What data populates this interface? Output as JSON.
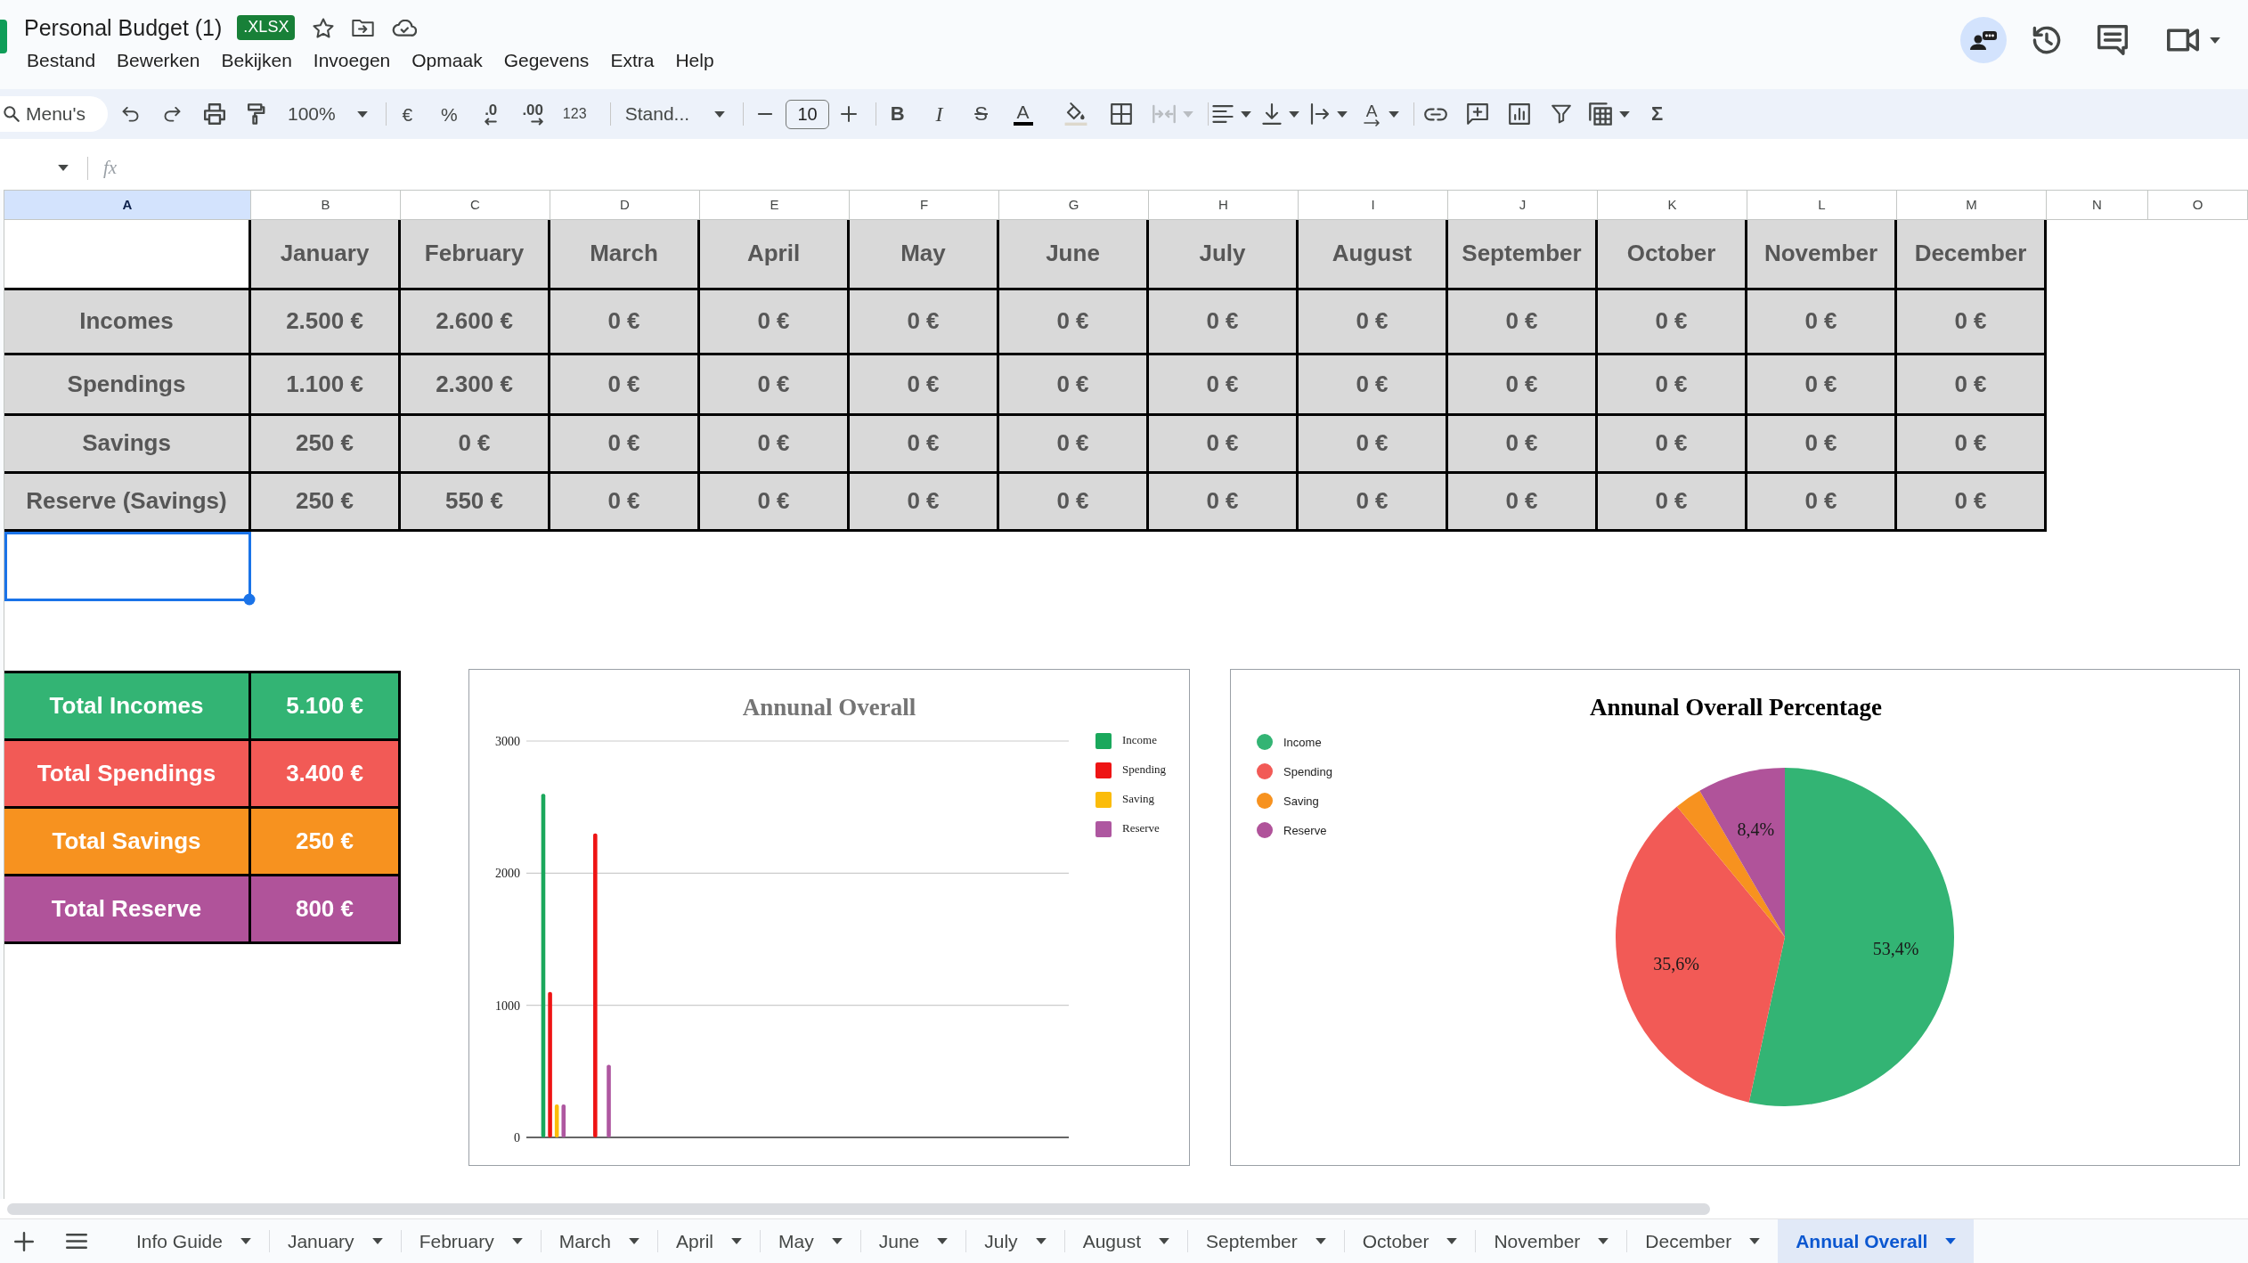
{
  "document": {
    "title": "Personal Budget (1)",
    "format": ".XLSX"
  },
  "menu": [
    "Bestand",
    "Bewerken",
    "Bekijken",
    "Invoegen",
    "Opmaak",
    "Gegevens",
    "Extra",
    "Help"
  ],
  "toolbar": {
    "menu_search": {
      "placeholder": "Menu's"
    },
    "zoom": "100%",
    "currency": "€",
    "percent": "%",
    "decrease_decimals": ".0",
    "increase_decimals": ".00",
    "more_formats": "123",
    "font": "Stand...",
    "font_size": "10",
    "bold": "B",
    "italic": "I",
    "strikethrough": "S",
    "text_color": "A",
    "merge_cells": {
      "disabled": true
    },
    "text_rotation": "A",
    "functions": "Σ"
  },
  "formula_bar": {
    "function_label": "fx"
  },
  "columns": [
    {
      "label": "A",
      "selected": true
    },
    {
      "label": "B",
      "selected": false
    },
    {
      "label": "C",
      "selected": false
    },
    {
      "label": "D",
      "selected": false
    },
    {
      "label": "E",
      "selected": false
    },
    {
      "label": "F",
      "selected": false
    },
    {
      "label": "G",
      "selected": false
    },
    {
      "label": "H",
      "selected": false
    },
    {
      "label": "I",
      "selected": false
    },
    {
      "label": "J",
      "selected": false
    },
    {
      "label": "K",
      "selected": false
    },
    {
      "label": "L",
      "selected": false
    },
    {
      "label": "M",
      "selected": false
    },
    {
      "label": "N",
      "selected": false
    },
    {
      "label": "O",
      "selected": false
    }
  ],
  "budget_table": {
    "months": [
      "January",
      "February",
      "March",
      "April",
      "May",
      "June",
      "July",
      "August",
      "September",
      "October",
      "November",
      "December"
    ],
    "rows": [
      {
        "label": "Incomes",
        "values": [
          "2.500 €",
          "2.600 €",
          "0 €",
          "0 €",
          "0 €",
          "0 €",
          "0 €",
          "0 €",
          "0 €",
          "0 €",
          "0 €",
          "0 €"
        ]
      },
      {
        "label": "Spendings",
        "values": [
          "1.100 €",
          "2.300 €",
          "0 €",
          "0 €",
          "0 €",
          "0 €",
          "0 €",
          "0 €",
          "0 €",
          "0 €",
          "0 €",
          "0 €"
        ]
      },
      {
        "label": "Savings",
        "values": [
          "250 €",
          "0 €",
          "0 €",
          "0 €",
          "0 €",
          "0 €",
          "0 €",
          "0 €",
          "0 €",
          "0 €",
          "0 €",
          "0 €"
        ]
      },
      {
        "label": "Reserve (Savings)",
        "values": [
          "250 €",
          "550 €",
          "0 €",
          "0 €",
          "0 €",
          "0 €",
          "0 €",
          "0 €",
          "0 €",
          "0 €",
          "0 €",
          "0 €"
        ]
      }
    ]
  },
  "totals": [
    {
      "label": "Total Incomes",
      "value": "5.100 €",
      "color": "#33b474"
    },
    {
      "label": "Total Spendings",
      "value": "3.400 €",
      "color": "#f25a56"
    },
    {
      "label": "Total Savings",
      "value": "250 €",
      "color": "#f7921f"
    },
    {
      "label": "Total Reserve",
      "value": "800 €",
      "color": "#b0539a"
    }
  ],
  "bar_chart": {
    "chart_data": {
      "type": "bar",
      "title": "Annunal Overall",
      "ylim": [
        0,
        3000
      ],
      "yticks": [
        0,
        1000,
        2000,
        3000
      ],
      "legend": "right",
      "series": [
        {
          "name": "Income",
          "color": "#1aa85c",
          "values": [
            2600,
            0,
            0,
            0,
            0,
            0,
            0,
            0,
            0,
            0,
            0,
            0
          ]
        },
        {
          "name": "Spending",
          "color": "#ee1414",
          "values": [
            1100,
            2300,
            0,
            0,
            0,
            0,
            0,
            0,
            0,
            0,
            0,
            0
          ]
        },
        {
          "name": "Saving",
          "color": "#fbbc0a",
          "values": [
            250,
            0,
            0,
            0,
            0,
            0,
            0,
            0,
            0,
            0,
            0,
            0
          ]
        },
        {
          "name": "Reserve",
          "color": "#ae57a0",
          "values": [
            250,
            550,
            0,
            0,
            0,
            0,
            0,
            0,
            0,
            0,
            0,
            0
          ]
        }
      ]
    }
  },
  "pie_chart": {
    "chart_data": {
      "type": "pie",
      "title": "Annunal Overall Percentage",
      "legend": "left",
      "categories": [
        "Income",
        "Spending",
        "Saving",
        "Reserve"
      ],
      "values": [
        53.4,
        35.6,
        2.6,
        8.4
      ],
      "colors": [
        "#33b474",
        "#f25a56",
        "#f7921f",
        "#b0539a"
      ],
      "value_labels": [
        "53,4%",
        "35,6%",
        null,
        "8,4%"
      ]
    }
  },
  "sheet_tabs": [
    {
      "label": "Info Guide",
      "selected": false
    },
    {
      "label": "January",
      "selected": false
    },
    {
      "label": "February",
      "selected": false
    },
    {
      "label": "March",
      "selected": false
    },
    {
      "label": "April",
      "selected": false
    },
    {
      "label": "May",
      "selected": false
    },
    {
      "label": "June",
      "selected": false
    },
    {
      "label": "July",
      "selected": false
    },
    {
      "label": "August",
      "selected": false
    },
    {
      "label": "September",
      "selected": false
    },
    {
      "label": "October",
      "selected": false
    },
    {
      "label": "November",
      "selected": false
    },
    {
      "label": "December",
      "selected": false
    },
    {
      "label": "Annual Overall",
      "selected": true
    }
  ]
}
